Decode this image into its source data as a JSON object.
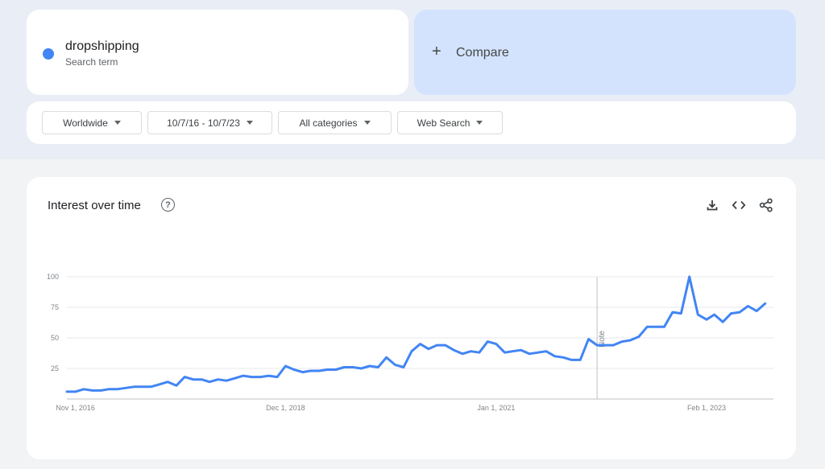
{
  "search_term": {
    "label": "dropshipping",
    "sublabel": "Search term",
    "color": "#4285f4"
  },
  "compare": {
    "plus": "+",
    "label": "Compare"
  },
  "filters": [
    {
      "label": "Worldwide"
    },
    {
      "label": "10/7/16 - 10/7/23"
    },
    {
      "label": "All categories"
    },
    {
      "label": "Web Search"
    }
  ],
  "chart_header": {
    "title": "Interest over time",
    "help": "?",
    "download_icon": "download-icon",
    "embed_icon": "embed-code-icon",
    "share_icon": "share-icon"
  },
  "chart_data": {
    "type": "line",
    "x_start": "2016-10-01",
    "x_end": "2023-10-01",
    "interval": "month",
    "ylim": [
      0,
      100
    ],
    "yticks": [
      25,
      50,
      75,
      100
    ],
    "xticks": [
      "Nov 1, 2016",
      "Dec 1, 2018",
      "Jan 1, 2021",
      "Feb 1, 2023"
    ],
    "annotation": {
      "label": "Note",
      "x": "2022-01-01"
    },
    "grid": true,
    "color": "#4285f4",
    "series": [
      {
        "values": [
          6,
          6,
          8,
          7,
          7,
          8,
          8,
          9,
          10,
          10,
          10,
          12,
          14,
          11,
          18,
          16,
          16,
          14,
          16,
          15,
          17,
          19,
          18,
          18,
          19,
          18,
          27,
          24,
          22,
          23,
          23,
          24,
          24,
          26,
          26,
          25,
          27,
          26,
          34,
          28,
          26,
          39,
          45,
          41,
          44,
          44,
          40,
          37,
          39,
          38,
          47,
          45,
          38,
          39,
          40,
          37,
          38,
          39,
          35,
          34,
          32,
          32,
          49,
          44,
          44,
          44,
          47,
          48,
          51,
          59,
          59,
          59,
          71,
          70,
          100,
          69,
          65,
          69,
          63,
          70,
          71,
          76,
          72,
          78
        ]
      }
    ]
  }
}
